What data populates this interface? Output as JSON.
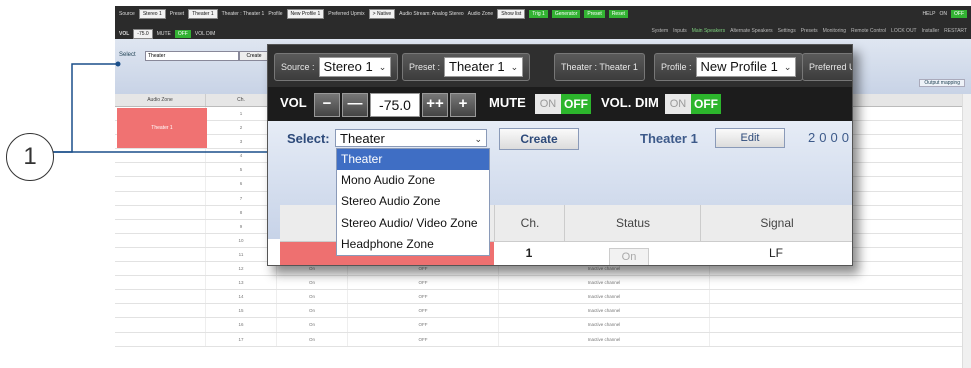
{
  "background_app": {
    "source_label": "Source",
    "source_value": "Stereo 1",
    "preset_label": "Preset",
    "preset_value": "Theater 1",
    "theater_label": "Theater : Theater 1",
    "profile_label": "Profile",
    "profile_value": "New Profile 1",
    "preferred_label": "Preferred Upmix",
    "preferred_value": "> Native",
    "audio_stream": "Audio Stream: Analog Stereo",
    "audio_zone_label": "Audio Zone",
    "audio_zone_value": "Show list",
    "buttons": [
      "Trig 1",
      "Generator",
      "Preset",
      "Reset"
    ],
    "help": "HELP",
    "on": "ON",
    "off": "OFF",
    "vol_label": "VOL",
    "vol_value": "-75.0",
    "mute_label": "MUTE",
    "vol_dim_label": "VOL DIM",
    "tabs": [
      "System",
      "Inputs",
      "Main Speakers",
      "Alternate Speakers",
      "Settings",
      "Presets",
      "Monitoring",
      "Remote Control"
    ],
    "lock_out": "LOCK OUT",
    "installer": "Installer",
    "restart": "RESTART",
    "select_label": "Select",
    "select_value": "Theater",
    "create": "Create",
    "output_mapping": "Output mapping",
    "col_audio_zone": "Audio Zone",
    "col_ch": "Ch.",
    "zone_name": "Theater 1",
    "rows": [
      {
        "ch": "1"
      },
      {
        "ch": "2"
      },
      {
        "ch": "3"
      },
      {
        "ch": "4"
      },
      {
        "ch": "5"
      },
      {
        "ch": "6"
      },
      {
        "ch": "7"
      },
      {
        "ch": "8"
      },
      {
        "ch": "9"
      },
      {
        "ch": "10"
      },
      {
        "ch": "11",
        "on": "On",
        "state": "OFF",
        "status": "Inactive channel"
      },
      {
        "ch": "12",
        "on": "On",
        "state": "OFF",
        "status": "Inactive channel"
      },
      {
        "ch": "13",
        "on": "On",
        "state": "OFF",
        "status": "Inactive channel"
      },
      {
        "ch": "14",
        "on": "On",
        "state": "OFF",
        "status": "Inactive channel"
      },
      {
        "ch": "15",
        "on": "On",
        "state": "OFF",
        "status": "Inactive channel"
      },
      {
        "ch": "16",
        "on": "On",
        "state": "OFF",
        "status": "Inactive channel"
      },
      {
        "ch": "17",
        "on": "On",
        "state": "OFF",
        "status": "Inactive channel"
      }
    ]
  },
  "callout": {
    "number": "1"
  },
  "zoom": {
    "source_label": "Source :",
    "source_value": "Stereo 1",
    "preset_label": "Preset :",
    "preset_value": "Theater 1",
    "theater_label": "Theater : Theater 1",
    "profile_label": "Profile :",
    "profile_value": "New Profile 1",
    "preferred_label": "Preferred U",
    "vol_label": "VOL",
    "vol_minus": "−",
    "vol_minus2": "—",
    "vol_value": "-75.0",
    "vol_plus2": "++",
    "vol_plus": "+",
    "mute_label": "MUTE",
    "on": "ON",
    "off": "OFF",
    "vol_dim_label": "VOL. DIM",
    "select_label": "Select:",
    "select_value": "Theater",
    "create": "Create",
    "preset_name": "Theater 1",
    "edit": "Edit",
    "number_partial": "2000",
    "dropdown": [
      "Theater",
      "Mono Audio Zone",
      "Stereo Audio Zone",
      "Stereo Audio/ Video Zone",
      "Headphone Zone"
    ],
    "col_ch": "Ch.",
    "col_status": "Status",
    "col_signal": "Signal",
    "row_ch": "1",
    "row_on": "On",
    "row_signal": "LF"
  }
}
